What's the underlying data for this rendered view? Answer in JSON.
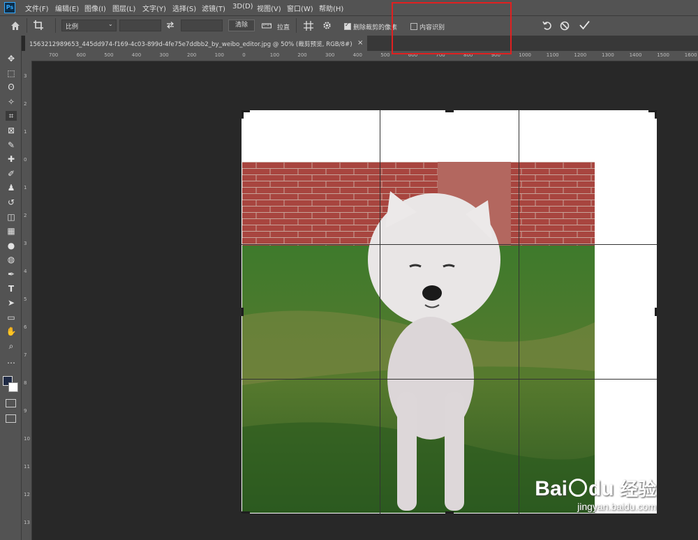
{
  "app": {
    "logo": "Ps"
  },
  "menu": [
    "文件(F)",
    "编辑(E)",
    "图像(I)",
    "图层(L)",
    "文字(Y)",
    "选择(S)",
    "滤镜(T)",
    "3D(D)",
    "视图(V)",
    "窗口(W)",
    "帮助(H)"
  ],
  "options": {
    "ratio_value": "比例",
    "clear_label": "清除",
    "straighten_label": "拉直",
    "delete_cropped_label": "删除裁剪的像素",
    "delete_cropped_checked": true,
    "content_aware_label": "内容识别",
    "content_aware_checked": false
  },
  "document": {
    "tab_title": "1563212989653_445dd974-f169-4c03-899d-4fe75e7ddbb2_by_weibo_editor.jpg @ 50% (裁剪预览, RGB/8#)",
    "close": "×"
  },
  "ruler": {
    "h_ticks": [
      "700",
      "600",
      "500",
      "400",
      "300",
      "200",
      "100",
      "0",
      "100",
      "200",
      "300",
      "400",
      "500",
      "600",
      "700",
      "800",
      "900",
      "1000",
      "1100",
      "1200",
      "1300",
      "1400",
      "1500",
      "1600",
      "1700"
    ],
    "v_ticks": [
      "3",
      "2",
      "1",
      "0",
      "1",
      "2",
      "3",
      "4",
      "5",
      "6",
      "7",
      "8",
      "9",
      "10",
      "11",
      "12",
      "13"
    ]
  },
  "icons": [
    "home-icon",
    "crop-icon",
    "swap-icon",
    "straighten-icon",
    "grid-overlay-icon",
    "gear-icon",
    "reset-icon",
    "cancel-icon",
    "commit-icon"
  ],
  "tools": [
    "move-tool-icon",
    "marquee-tool-icon",
    "lasso-tool-icon",
    "magic-wand-tool-icon",
    "crop-tool-icon",
    "frame-tool-icon",
    "eyedropper-tool-icon",
    "healing-tool-icon",
    "brush-tool-icon",
    "stamp-tool-icon",
    "history-brush-tool-icon",
    "eraser-tool-icon",
    "bucket-tool-icon",
    "blur-tool-icon",
    "dodge-tool-icon",
    "pen-tool-icon",
    "type-tool-icon",
    "path-select-tool-icon",
    "rectangle-tool-icon",
    "hand-tool-icon",
    "zoom-tool-icon",
    "more-tools-icon"
  ],
  "colors": {
    "accent": "#31a8ff",
    "highlight": "#e02020",
    "foreground": "#1f2a44",
    "background": "#ffffff"
  },
  "watermark": {
    "brand": "Bai",
    "brand2": "du",
    "cn": "经验",
    "url": "jingyan.baidu.com"
  }
}
